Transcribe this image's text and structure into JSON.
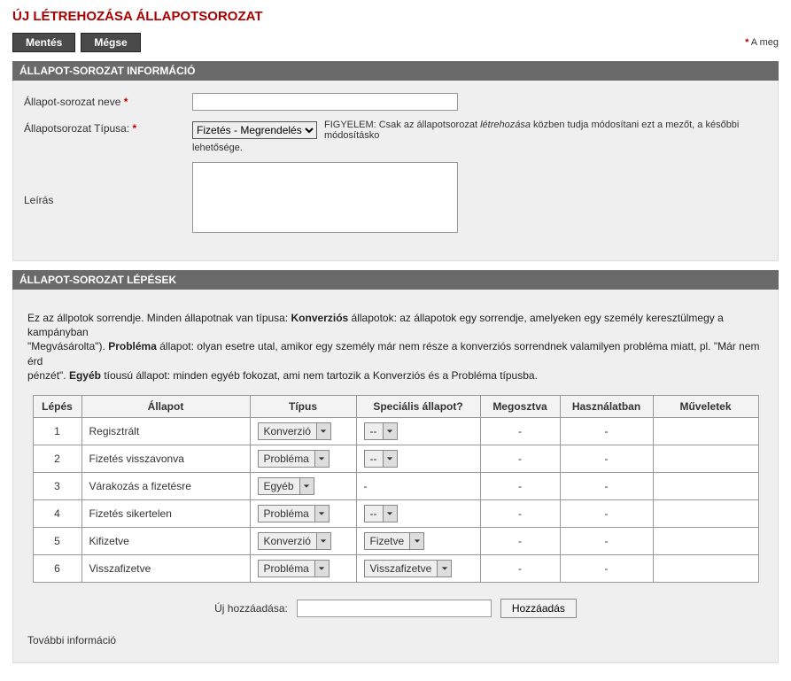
{
  "page": {
    "title": "ÚJ LÉTREHOZÁSA ÁLLAPOTSOROZAT",
    "required_note_prefix": "*",
    "required_note": " A meg"
  },
  "toolbar": {
    "save": "Mentés",
    "cancel": "Mégse"
  },
  "sections": {
    "info_header": "ÁLLAPOT-SOROZAT INFORMÁCIÓ",
    "steps_header": "ÁLLAPOT-SOROZAT LÉPÉSEK"
  },
  "form": {
    "name_label": "Állapot-sorozat neve",
    "name_value": "",
    "type_label": "Állapotsorozat Típusa:",
    "type_selected": "Fizetés - Megrendelés",
    "type_hint_prefix": "FIGYELEM: Csak az állapotsorozat ",
    "type_hint_em": "létrehozása",
    "type_hint_suffix": " közben tudja módosítani ezt a mezőt, a későbbi módosításko",
    "type_hint_line2": "lehetősége.",
    "desc_label": "Leírás",
    "desc_value": ""
  },
  "steps_intro": {
    "p1a": "Ez az állpotok sorrendje. Minden állapotnak van típusa: ",
    "p1b": "Konverziós",
    "p1c": " állapotok: az állapotok egy sorrendje, amelyeken egy személy keresztülmegy a kampányban",
    "p2a": "\"Megvásárolta\"). ",
    "p2b": "Probléma",
    "p2c": " állapot: olyan esetre utal, amikor egy személy már nem része a konverziós sorrendnek valamilyen probléma miatt, pl. \"Már nem érd",
    "p3a": "pénzét\". ",
    "p3b": "Egyéb",
    "p3c": " tíousú állapot: minden egyéb fokozat, ami nem tartozik a Konverziós és a Probléma típusba."
  },
  "table": {
    "headers": {
      "step": "Lépés",
      "state": "Állapot",
      "type": "Típus",
      "special": "Speciális állapot?",
      "shared": "Megosztva",
      "inuse": "Használatban",
      "ops": "Műveletek"
    },
    "rows": [
      {
        "step": "1",
        "state": "Regisztrált",
        "type": "Konverzió",
        "special": "--",
        "shared": "-",
        "inuse": "-",
        "ops": ""
      },
      {
        "step": "2",
        "state": "Fizetés visszavonva",
        "type": "Probléma",
        "special": "--",
        "shared": "-",
        "inuse": "-",
        "ops": ""
      },
      {
        "step": "3",
        "state": "Várakozás a fizetésre",
        "type": "Egyéb",
        "special": "-",
        "shared": "-",
        "inuse": "-",
        "ops": ""
      },
      {
        "step": "4",
        "state": "Fizetés sikertelen",
        "type": "Probléma",
        "special": "--",
        "shared": "-",
        "inuse": "-",
        "ops": ""
      },
      {
        "step": "5",
        "state": "Kifizetve",
        "type": "Konverzió",
        "special": "Fizetve",
        "shared": "-",
        "inuse": "-",
        "ops": ""
      },
      {
        "step": "6",
        "state": "Visszafizetve",
        "type": "Probléma",
        "special": "Visszafizetve",
        "shared": "-",
        "inuse": "-",
        "ops": ""
      }
    ]
  },
  "add": {
    "label": "Új hozzáadása:",
    "value": "",
    "button": "Hozzáadás"
  },
  "more_info": "További információ"
}
